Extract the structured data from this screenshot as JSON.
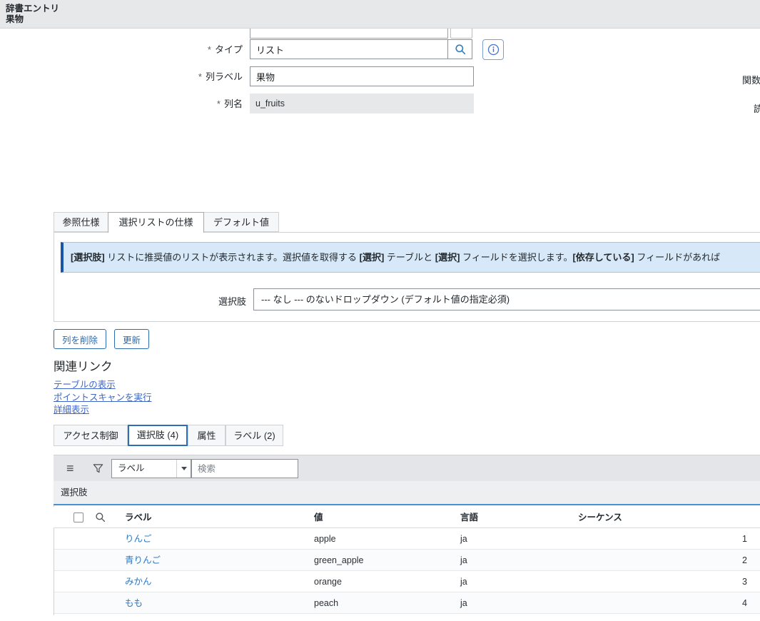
{
  "header": {
    "title": "辞書エントリ",
    "record": "果物"
  },
  "icons": {
    "menu_glyph": "≡"
  },
  "form": {
    "required_mark": "*",
    "type_field": {
      "label": "タイプ",
      "value": "リスト"
    },
    "column_label_field": {
      "label": "列ラベル",
      "value": "果物"
    },
    "column_name_field": {
      "label": "列名",
      "value": "u_fruits"
    },
    "right_edge": {
      "first": "関数",
      "second": "読"
    }
  },
  "spec_tabs": {
    "reference": "参照仕様",
    "choice_list": "選択リストの仕様",
    "default_value": "デフォルト値"
  },
  "info_message": {
    "p1": "[選択肢]",
    "p2": " リストに推奨値のリストが表示されます。選択値を取得する ",
    "p3": "[選択]",
    "p4": " テーブルと ",
    "p5": "[選択]",
    "p6": " フィールドを選択します。",
    "p7": "[依存している]",
    "p8": " フィールドがあれば"
  },
  "choices_field": {
    "label": "選択肢",
    "value": "--- なし --- のないドロップダウン (デフォルト値の指定必須)"
  },
  "actions": {
    "delete_column": "列を削除",
    "update": "更新"
  },
  "related_links": {
    "title": "関連リンク",
    "show_table": "テーブルの表示",
    "run_point_scan": "ポイントスキャンを実行",
    "show_details": "詳細表示"
  },
  "record_tabs": {
    "access_control": "アクセス制御",
    "choices": "選択肢 (4)",
    "attributes": "属性",
    "labels": "ラベル (2)"
  },
  "choice_list": {
    "breadcrumb_field": "ラベル",
    "search_placeholder": "検索",
    "title": "選択肢",
    "headers": {
      "label": "ラベル",
      "value": "値",
      "language": "言語",
      "sequence": "シーケンス"
    },
    "rows": [
      {
        "label": "りんご",
        "value": "apple",
        "language": "ja",
        "sequence": "1"
      },
      {
        "label": "青りんご",
        "value": "green_apple",
        "language": "ja",
        "sequence": "2"
      },
      {
        "label": "みかん",
        "value": "orange",
        "language": "ja",
        "sequence": "3"
      },
      {
        "label": "もも",
        "value": "peach",
        "language": "ja",
        "sequence": "4"
      }
    ]
  }
}
